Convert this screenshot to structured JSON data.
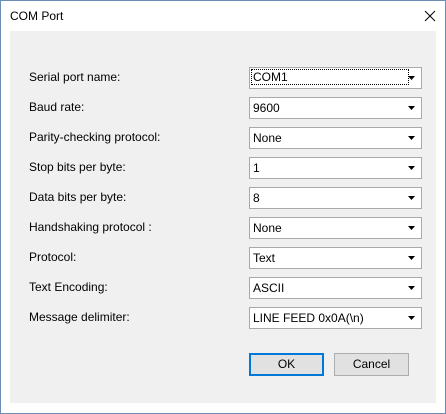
{
  "window": {
    "title": "COM Port"
  },
  "fields": [
    {
      "label": "Serial port name:",
      "value": "COM1"
    },
    {
      "label": "Baud rate:",
      "value": "9600"
    },
    {
      "label": "Parity-checking protocol:",
      "value": "None"
    },
    {
      "label": "Stop bits per byte:",
      "value": "1"
    },
    {
      "label": "Data bits per byte:",
      "value": "8"
    },
    {
      "label": "Handshaking protocol :",
      "value": "None"
    },
    {
      "label": "Protocol:",
      "value": "Text"
    },
    {
      "label": "Text Encoding:",
      "value": "ASCII"
    },
    {
      "label": "Message delimiter:",
      "value": "LINE FEED 0x0A(\\n)"
    }
  ],
  "buttons": {
    "ok": "OK",
    "cancel": "Cancel"
  },
  "icons": {
    "close": "close-icon",
    "dropdown": "chevron-down-icon"
  },
  "colors": {
    "accent": "#0078d7",
    "client_bg": "#f0f0f0"
  }
}
